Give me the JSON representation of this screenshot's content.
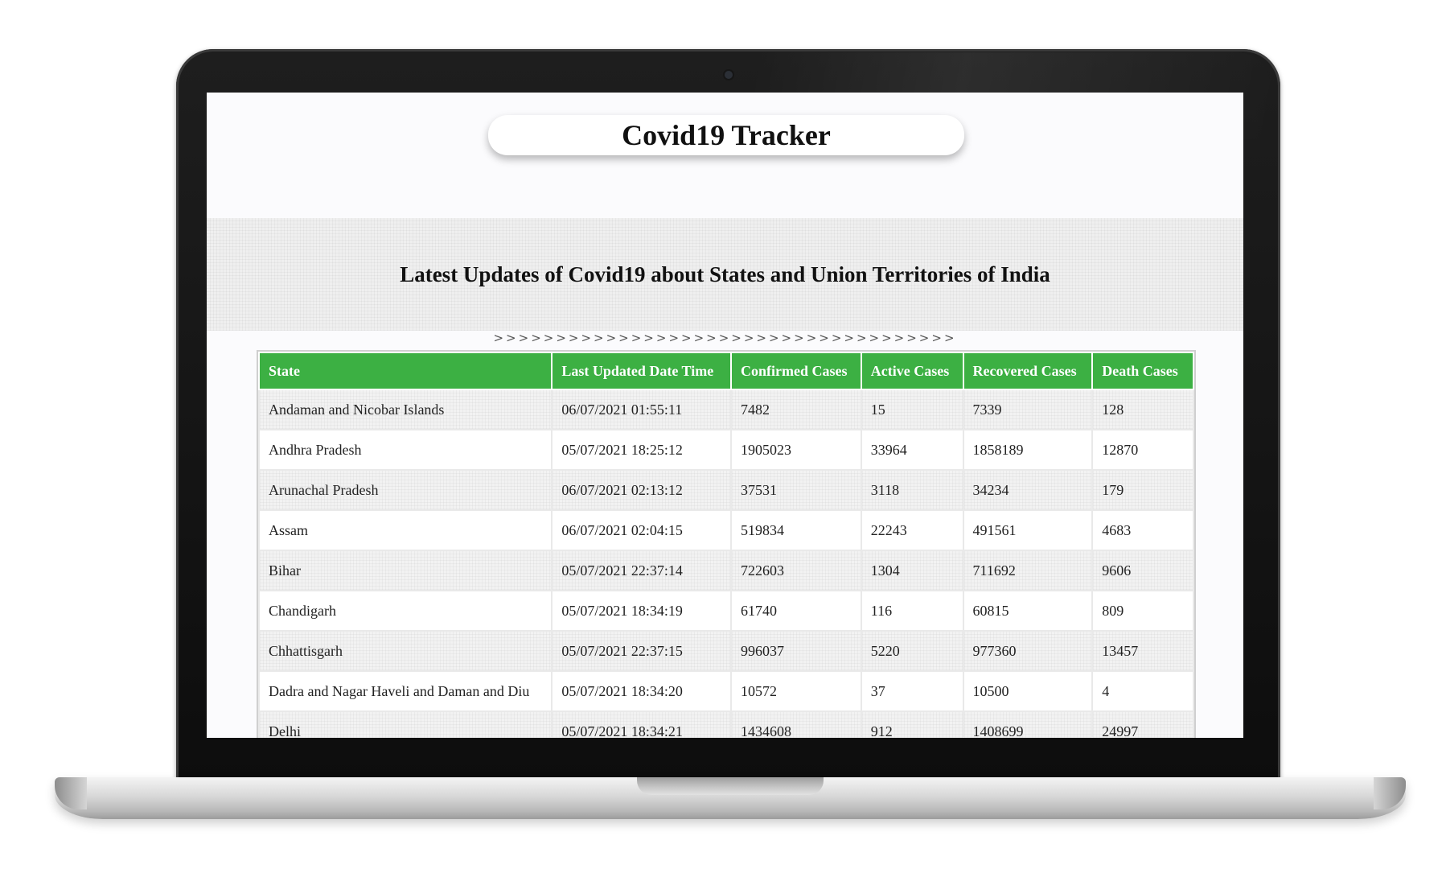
{
  "page": {
    "title": "Covid19 Tracker",
    "subtitle": "Latest Updates of Covid19 about States and Union Territories of India",
    "arrows": ">>>>>>>>>>>>>>>>>>>>>>>>>>>>>>>>>>>>>"
  },
  "table": {
    "headers": [
      "State",
      "Last Updated Date Time",
      "Confirmed Cases",
      "Active Cases",
      "Recovered Cases",
      "Death Cases"
    ],
    "rows": [
      [
        "Andaman and Nicobar Islands",
        "06/07/2021 01:55:11",
        "7482",
        "15",
        "7339",
        "128"
      ],
      [
        "Andhra Pradesh",
        "05/07/2021 18:25:12",
        "1905023",
        "33964",
        "1858189",
        "12870"
      ],
      [
        "Arunachal Pradesh",
        "06/07/2021 02:13:12",
        "37531",
        "3118",
        "34234",
        "179"
      ],
      [
        "Assam",
        "06/07/2021 02:04:15",
        "519834",
        "22243",
        "491561",
        "4683"
      ],
      [
        "Bihar",
        "05/07/2021 22:37:14",
        "722603",
        "1304",
        "711692",
        "9606"
      ],
      [
        "Chandigarh",
        "05/07/2021 18:34:19",
        "61740",
        "116",
        "60815",
        "809"
      ],
      [
        "Chhattisgarh",
        "05/07/2021 22:37:15",
        "996037",
        "5220",
        "977360",
        "13457"
      ],
      [
        "Dadra and Nagar Haveli and Daman and Diu",
        "05/07/2021 18:34:20",
        "10572",
        "37",
        "10500",
        "4"
      ],
      [
        "Delhi",
        "05/07/2021 18:34:21",
        "1434608",
        "912",
        "1408699",
        "24997"
      ]
    ]
  },
  "colors": {
    "header_green": "#3cb043",
    "screen_bg": "#fbfbfd"
  }
}
